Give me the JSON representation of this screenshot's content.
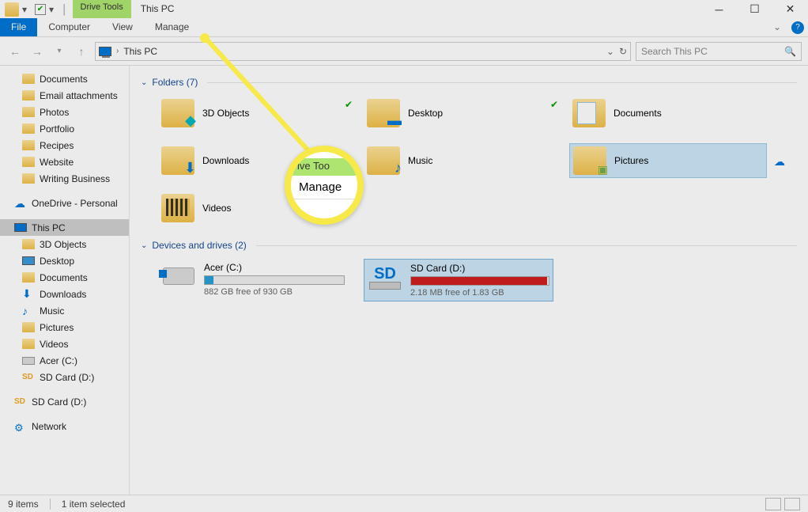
{
  "title": "This PC",
  "contextTab": "Drive Tools",
  "ribbon": {
    "file": "File",
    "computer": "Computer",
    "view": "View",
    "manage": "Manage"
  },
  "address": {
    "location": "This PC"
  },
  "search": {
    "placeholder": "Search This PC"
  },
  "sidebar": {
    "quick": [
      "Documents",
      "Email attachments",
      "Photos",
      "Portfolio",
      "Recipes",
      "Website",
      "Writing Business"
    ],
    "onedrive": "OneDrive - Personal",
    "thispc": "This PC",
    "pcItems": [
      "3D Objects",
      "Desktop",
      "Documents",
      "Downloads",
      "Music",
      "Pictures",
      "Videos",
      "Acer (C:)",
      "SD Card (D:)"
    ],
    "sdcard": "SD Card (D:)",
    "network": "Network"
  },
  "sections": {
    "folders": "Folders (7)",
    "drives": "Devices and drives (2)"
  },
  "folders": [
    {
      "name": "3D Objects",
      "icon": "3d",
      "sync": true
    },
    {
      "name": "Desktop",
      "icon": "desktop",
      "sync": true
    },
    {
      "name": "Documents",
      "icon": "doc"
    },
    {
      "name": "Downloads",
      "icon": "dl"
    },
    {
      "name": "Music",
      "icon": "music"
    },
    {
      "name": "Pictures",
      "icon": "pic",
      "selected": true,
      "cloud": true
    },
    {
      "name": "Videos",
      "icon": "vid"
    }
  ],
  "drives": [
    {
      "name": "Acer (C:)",
      "free": "882 GB free of 930 GB",
      "fill": 6,
      "type": "hdd"
    },
    {
      "name": "SD Card (D:)",
      "free": "2.18 MB free of 1.83 GB",
      "fill": 99,
      "type": "sd",
      "selected": true
    }
  ],
  "status": {
    "items": "9 items",
    "selected": "1 item selected"
  },
  "callout": {
    "top": "ive Too",
    "main": "Manage"
  }
}
